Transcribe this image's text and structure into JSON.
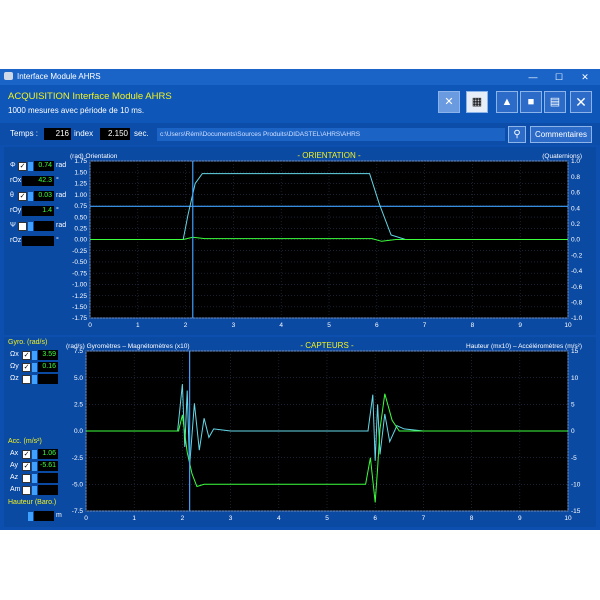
{
  "window": {
    "title": "Interface Module AHRS",
    "minimize": "—",
    "maximize": "☐",
    "close": "✕"
  },
  "header": {
    "title": "ACQUISITION Interface Module AHRS",
    "subtitle": "1000 mesures avec période de 10 ms."
  },
  "info": {
    "temps_label": "Temps :",
    "temps_value": "216",
    "index_label": "index",
    "index_value": "2.150",
    "sec_label": "sec.",
    "path": "c:\\Users\\Rémi\\Documents\\Sources Produits\\DIDASTEL\\AHRS\\AHRS",
    "comments_button": "Commentaires"
  },
  "orientation_controls": [
    {
      "sym": "Φ",
      "unit": "rad",
      "value": "0.74",
      "checked": true
    },
    {
      "sym": "rOx",
      "unit": "°",
      "value": "42.3"
    },
    {
      "sym": "θ",
      "unit": "rad",
      "value": "0.03",
      "checked": true
    },
    {
      "sym": "rOy",
      "unit": "°",
      "value": "1.4"
    },
    {
      "sym": "Ψ",
      "unit": "rad",
      "value": "",
      "checked": false
    },
    {
      "sym": "rOz",
      "unit": "°",
      "value": ""
    }
  ],
  "sensor_controls": {
    "gyro_label": "Gyro. (rad/s)",
    "gyro": [
      {
        "sym": "Ωx",
        "value": "3.59",
        "checked": true
      },
      {
        "sym": "Ωy",
        "value": "0.16",
        "checked": true
      },
      {
        "sym": "Ωz",
        "value": "",
        "checked": false
      }
    ],
    "acc_label": "Acc. (m/s²)",
    "acc": [
      {
        "sym": "Ax",
        "value": "1.06",
        "checked": true
      },
      {
        "sym": "Ay",
        "value": "-5.61",
        "checked": true
      },
      {
        "sym": "Az",
        "value": "",
        "checked": false
      },
      {
        "sym": "Am",
        "value": "",
        "checked": false
      }
    ],
    "height_label": "Hauteur (Baro.)",
    "height_unit": "m"
  },
  "colors": {
    "accent": "#f2f21e",
    "background": "#0d4fae",
    "plot_bg": "#000000",
    "cursor": "#3fa0ff",
    "series_cyan": "#64d8e8",
    "series_green": "#3cff3c"
  },
  "chart_data": [
    {
      "type": "line",
      "title": "- ORIENTATION -",
      "ylabel": "(rad) Orientation",
      "y2label": "(Quaternions)",
      "xlim": [
        0,
        10
      ],
      "ylim": [
        -1.75,
        1.75
      ],
      "y2lim": [
        -1.0,
        1.0
      ],
      "x_ticks": [
        "0",
        "1",
        "2",
        "3",
        "4",
        "5",
        "6",
        "7",
        "8",
        "9",
        "10"
      ],
      "y_ticks": [
        "1.75",
        "1.50",
        "1.25",
        "1.00",
        "0.75",
        "0.50",
        "0.25",
        "0.00",
        "-0.25",
        "-0.50",
        "-0.75",
        "-1.00",
        "-1.25",
        "-1.50",
        "-1.75"
      ],
      "y2_ticks": [
        "1.0",
        "0.8",
        "0.6",
        "0.4",
        "0.2",
        "0.0",
        "-0.2",
        "-0.4",
        "-0.6",
        "-0.8",
        "-1.0"
      ],
      "cursor_x": 2.15,
      "hline_y": 0.74,
      "series": [
        {
          "color": "#64d8e8",
          "x": [
            0,
            1.95,
            2.05,
            2.2,
            2.35,
            2.5,
            5.85,
            6.05,
            6.3,
            6.6,
            10
          ],
          "y": [
            0,
            0,
            0.55,
            1.25,
            1.47,
            1.47,
            1.47,
            0.8,
            0.1,
            0,
            0
          ]
        },
        {
          "color": "#3cff3c",
          "x": [
            0,
            1.95,
            2.15,
            2.4,
            5.9,
            6.1,
            6.4,
            10
          ],
          "y": [
            0,
            0,
            0.05,
            0.02,
            0.02,
            -0.04,
            0,
            0
          ]
        }
      ]
    },
    {
      "type": "line",
      "title": "- CAPTEURS -",
      "ylabel": "(rad/s) Gyromètres – Magnétomètres (x10)",
      "y2label": "Hauteur (mx10) – Accéléromètres  (m/s²)",
      "xlim": [
        0,
        10
      ],
      "ylim": [
        -7.5,
        7.5
      ],
      "y2lim": [
        -15,
        15
      ],
      "x_ticks": [
        "0",
        "1",
        "2",
        "3",
        "4",
        "5",
        "6",
        "7",
        "8",
        "9",
        "10"
      ],
      "y_ticks": [
        "7.5",
        "5.0",
        "2.5",
        "0.0",
        "-2.5",
        "-5.0",
        "-7.5"
      ],
      "y2_ticks": [
        "15",
        "10",
        "5",
        "0",
        "-5",
        "-10",
        "-15"
      ],
      "cursor_x": 2.15,
      "series": [
        {
          "color": "#64d8e8",
          "x": [
            0,
            1.9,
            2.0,
            2.05,
            2.1,
            2.15,
            2.25,
            2.35,
            2.45,
            2.55,
            2.65,
            3.0,
            5.85,
            5.95,
            6.0,
            6.05,
            6.1,
            6.2,
            6.3,
            6.45,
            6.6,
            7,
            10
          ],
          "y": [
            0,
            0,
            4.4,
            -1.5,
            3.8,
            -3.3,
            2.6,
            -1.8,
            1.2,
            -0.6,
            0.2,
            0,
            0,
            3.4,
            -2.8,
            2.5,
            -2.2,
            1.6,
            -1.0,
            0.5,
            0.2,
            0,
            0
          ]
        },
        {
          "color": "#3cff3c",
          "x": [
            0,
            1.92,
            2.0,
            2.1,
            2.2,
            2.3,
            2.45,
            5.8,
            5.9,
            6.0,
            6.05,
            6.1,
            6.2,
            6.35,
            6.5,
            10
          ],
          "y": [
            0,
            0,
            1.5,
            -2.0,
            -4.0,
            -5.2,
            -5.0,
            -5.0,
            -2.5,
            -6.7,
            -3.5,
            0.2,
            3.5,
            1.0,
            0,
            0
          ]
        }
      ]
    }
  ]
}
